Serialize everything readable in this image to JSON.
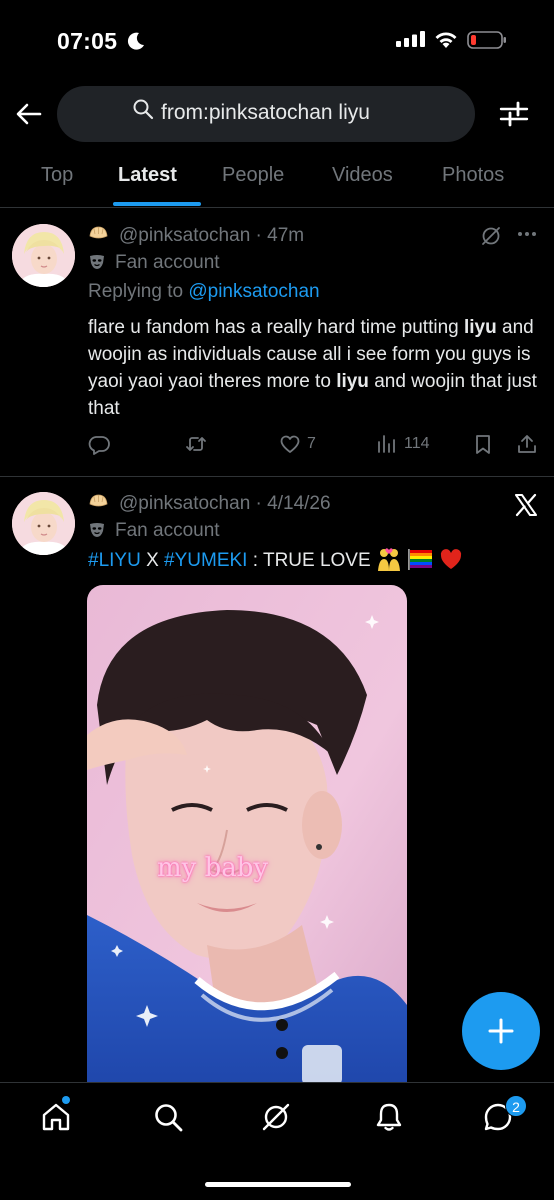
{
  "status_bar": {
    "time": "07:05"
  },
  "search": {
    "query": "from:pinksatochan liyu"
  },
  "tabs": [
    {
      "label": "Top"
    },
    {
      "label": "Latest"
    },
    {
      "label": "People"
    },
    {
      "label": "Videos"
    },
    {
      "label": "Photos"
    }
  ],
  "active_tab": "Latest",
  "tweets": [
    {
      "handle": "@pinksatochan",
      "time": "· 47m",
      "account_label": "Fan account",
      "replying_prefix": "Replying to ",
      "replying_to": "@pinksatochan",
      "text_segments": [
        {
          "t": "flare u fandom has a really hard time putting ",
          "bold": false
        },
        {
          "t": "liyu",
          "bold": true
        },
        {
          "t": " and woojin as individuals cause all i see form you guys is yaoi yaoi yaoi theres more to ",
          "bold": false
        },
        {
          "t": "liyu",
          "bold": true
        },
        {
          "t": " and woojin that just that",
          "bold": false
        }
      ],
      "stats": {
        "replies": "",
        "retweets": "",
        "likes": "7",
        "views": "114"
      }
    },
    {
      "handle": "@pinksatochan",
      "time": "· 4/14/26",
      "account_label": "Fan account",
      "hashtag1": "#LIYU",
      "mid_text": " X ",
      "hashtag2": "#YUMEKI",
      "tail_text": " : TRUE LOVE ",
      "media_caption": "my baby"
    }
  ],
  "nav": {
    "messages_badge": "2"
  },
  "colors": {
    "accent": "#1d9bf0",
    "background": "#000000",
    "secondary_text": "#71767b",
    "divider": "#2f3336"
  },
  "icons": [
    "moon-icon",
    "signal-icon",
    "wifi-icon",
    "battery-icon",
    "back-arrow-icon",
    "search-icon",
    "filter-icon",
    "grok-icon",
    "more-icon",
    "x-logo-icon",
    "reply-icon",
    "retweet-icon",
    "like-icon",
    "views-icon",
    "bookmark-icon",
    "share-icon",
    "plus-icon",
    "home-icon",
    "explore-icon",
    "grok-nav-icon",
    "notifications-icon",
    "messages-icon"
  ]
}
